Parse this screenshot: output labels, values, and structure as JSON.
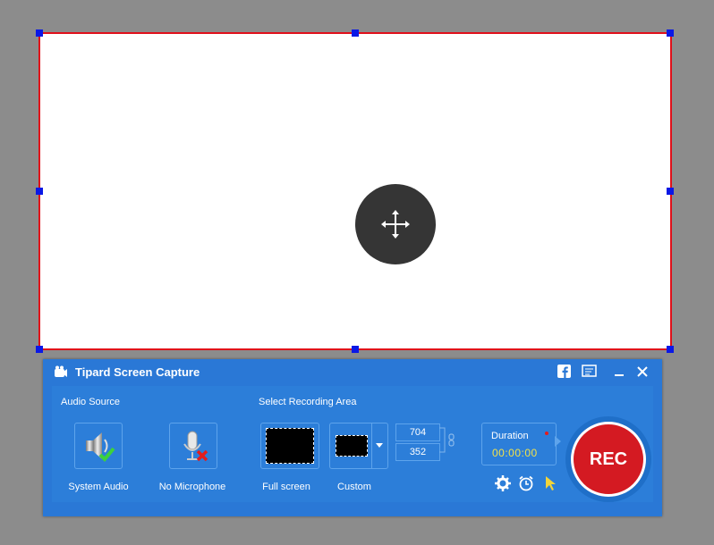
{
  "app": {
    "title": "Tipard Screen Capture"
  },
  "sections": {
    "audio_source": "Audio Source",
    "recording_area": "Select Recording Area"
  },
  "audio": {
    "system_label": "System Audio",
    "mic_label": "No Microphone"
  },
  "area": {
    "fullscreen_label": "Full screen",
    "custom_label": "Custom",
    "width": "704",
    "height": "352"
  },
  "duration": {
    "label": "Duration",
    "time": "00:00:00"
  },
  "rec": {
    "label": "REC"
  },
  "colors": {
    "panel": "#2a78d6",
    "region_border": "#e0101a",
    "handle": "#0a18e6",
    "rec": "#d41a22",
    "time": "#f2e24a"
  }
}
